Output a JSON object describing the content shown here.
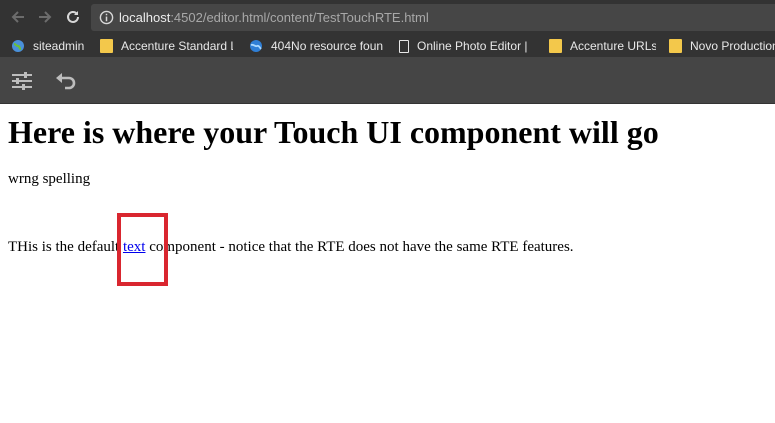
{
  "browser": {
    "url": {
      "host": "localhost",
      "path": ":4502/editor.html/content/TestTouchRTE.html"
    },
    "bookmarks": [
      {
        "label": "siteadmin",
        "icon": "globe-icon"
      },
      {
        "label": "Accenture Standard L",
        "icon": "folder-icon"
      },
      {
        "label": "404No resource foun",
        "icon": "globe-icon"
      },
      {
        "label": "Online Photo Editor |",
        "icon": "document-icon"
      },
      {
        "label": "Accenture URLs",
        "icon": "folder-icon"
      },
      {
        "label": "Novo Production",
        "icon": "folder-icon"
      }
    ]
  },
  "editor_toolbar": {
    "buttons": [
      {
        "name": "page-properties",
        "icon": "sliders-icon"
      },
      {
        "name": "undo",
        "icon": "undo-icon"
      }
    ]
  },
  "page": {
    "heading": "Here is where your Touch UI component will go",
    "para1": "wrng spelling",
    "para2_before": "THis is the default ",
    "para2_link": "text",
    "para2_after": " component - notice that the RTE does not have the same RTE features."
  },
  "colors": {
    "chrome_bg": "#333333",
    "toolbar_bg": "#454545",
    "highlight": "#d9262f",
    "link": "#0000ee",
    "folder": "#f3c84b"
  }
}
